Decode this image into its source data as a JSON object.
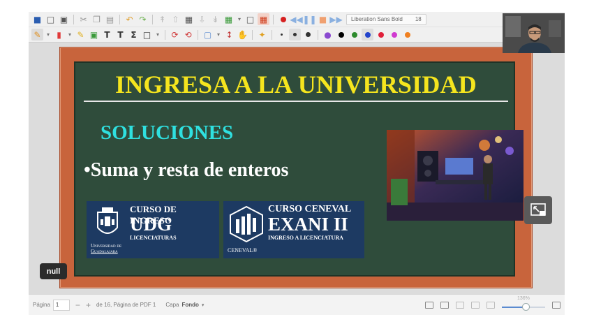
{
  "toolbar": {
    "font_name": "Liberation Sans Bold",
    "font_size": "18",
    "icons_row1": [
      "save-icon",
      "new-icon",
      "open-icon",
      "cut-icon",
      "copy-icon",
      "paste-icon",
      "undo-icon",
      "redo-icon",
      "first-page-icon",
      "prev-page-icon",
      "page-icon",
      "next-page-icon",
      "last-page-icon",
      "insert-page-icon",
      "dropdown-icon",
      "delete-page-icon",
      "fit-icon",
      "record-icon",
      "rewind-icon",
      "pause-icon",
      "stop-icon",
      "forward-icon"
    ],
    "icons_row2": [
      "pen-icon",
      "highlighter-icon",
      "marker-icon",
      "image-icon",
      "text-icon",
      "sigma-icon",
      "shape-icon",
      "undo-circle-icon",
      "eraser-icon",
      "rectangle-select-icon",
      "vertical-space-icon",
      "hand-icon",
      "magic-wand-icon"
    ],
    "pen_colors": [
      "#000000",
      "#2e8b2e",
      "#2244cc",
      "#e0203a",
      "#d03ad0",
      "#f08020"
    ],
    "accent": "#e03a2a"
  },
  "slide": {
    "title": "INGRESA A LA UNIVERSIDAD",
    "subtitle": "SOLUCIONES",
    "bullet": "•Suma y resta de enteros",
    "udg": {
      "line1": "CURSO DE INGRESO",
      "line2": "UDG",
      "line3": "LICENCIATURAS",
      "line4a": "Universidad de",
      "line4b": "Guadalajara"
    },
    "exani": {
      "line1": "CURSO CENEVAL",
      "line2": "EXANI II",
      "line3": "INGRESO A LICENCIATURA",
      "line4": "CENEVAL®"
    },
    "colors": {
      "board": "#2f4c3b",
      "frame": "#c8643c",
      "title": "#f5e51e",
      "subtitle": "#2fe0e0"
    }
  },
  "status": {
    "page_label": "Página",
    "page_value": "1",
    "minus": "−",
    "plus": "+",
    "page_info": "de 16, Página de PDF 1",
    "layer_label": "Capa",
    "layer_value": "Fondo",
    "zoom": "136%",
    "zoom_fraction": 0.55
  },
  "overlay": {
    "null_label": "null"
  }
}
